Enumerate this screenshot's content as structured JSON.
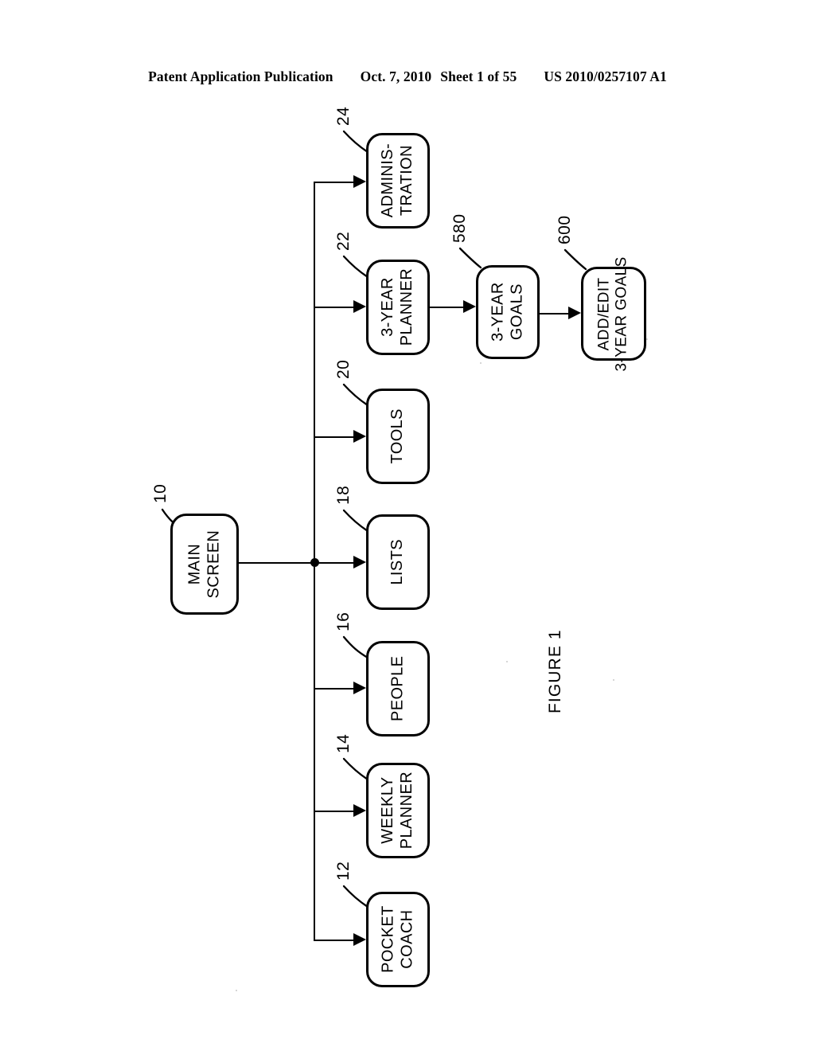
{
  "header": {
    "publication": "Patent Application Publication",
    "date": "Oct. 7, 2010",
    "sheet": "Sheet 1 of 55",
    "patent_number": "US 2010/0257107 A1"
  },
  "figure": {
    "caption": "FIGURE 1",
    "orientation": "rotated-90-ccw"
  },
  "diagram": {
    "type": "flowchart",
    "nodes": [
      {
        "id": "main-screen",
        "label": "MAIN\nSCREEN",
        "ref": "10"
      },
      {
        "id": "pocket-coach",
        "label": "POCKET\nCOACH",
        "ref": "12"
      },
      {
        "id": "weekly-planner",
        "label": "WEEKLY\nPLANNER",
        "ref": "14"
      },
      {
        "id": "people",
        "label": "PEOPLE",
        "ref": "16"
      },
      {
        "id": "lists",
        "label": "LISTS",
        "ref": "18"
      },
      {
        "id": "tools",
        "label": "TOOLS",
        "ref": "20"
      },
      {
        "id": "three-year-planner",
        "label": "3-YEAR\nPLANNER",
        "ref": "22"
      },
      {
        "id": "administration",
        "label": "ADMINIS-\nTRATION",
        "ref": "24"
      },
      {
        "id": "three-year-goals",
        "label": "3-YEAR\nGOALS",
        "ref": "580"
      },
      {
        "id": "add-edit-goals",
        "label": "ADD/EDIT\n3-YEAR GOALS",
        "ref": "600"
      }
    ],
    "edges": [
      {
        "from": "main-screen",
        "to": "bus",
        "style": "line-with-junction"
      },
      {
        "from": "bus",
        "to": "pocket-coach",
        "style": "arrow"
      },
      {
        "from": "bus",
        "to": "weekly-planner",
        "style": "arrow"
      },
      {
        "from": "bus",
        "to": "people",
        "style": "arrow"
      },
      {
        "from": "bus",
        "to": "lists",
        "style": "arrow"
      },
      {
        "from": "bus",
        "to": "tools",
        "style": "arrow"
      },
      {
        "from": "bus",
        "to": "three-year-planner",
        "style": "arrow"
      },
      {
        "from": "bus",
        "to": "administration",
        "style": "arrow"
      },
      {
        "from": "three-year-planner",
        "to": "three-year-goals",
        "style": "arrow"
      },
      {
        "from": "three-year-goals",
        "to": "add-edit-goals",
        "style": "arrow"
      }
    ]
  }
}
